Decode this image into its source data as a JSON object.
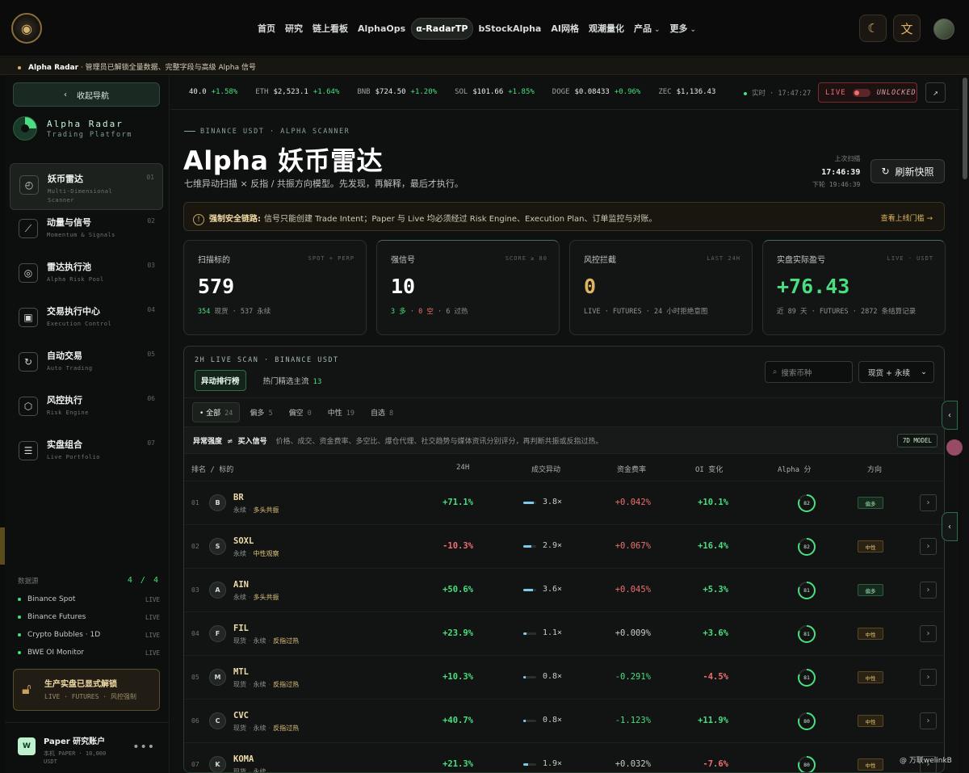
{
  "nav": {
    "links": [
      "首页",
      "研究",
      "链上看板",
      "AlphaOps",
      "α-RadarTP",
      "bStockAlpha",
      "AI网格",
      "观潮量化"
    ],
    "active_index": 4,
    "dropdowns": [
      "产品",
      "更多"
    ]
  },
  "banner": {
    "strong": "Alpha Radar",
    "text": " · 管理员已解锁全量数据、完整字段与高级 Alpha 信号"
  },
  "sidebar": {
    "collapse_label": "收起导航",
    "brand_title": "Alpha Radar",
    "brand_sub": "Trading Platform",
    "items": [
      {
        "label": "妖币雷达",
        "sub": "Multi-Dimensional Scanner",
        "num": "01",
        "icon": "◴"
      },
      {
        "label": "动量与信号",
        "sub": "Momentum & Signals",
        "num": "02",
        "icon": "⟋"
      },
      {
        "label": "雷达执行池",
        "sub": "Alpha Risk Pool",
        "num": "03",
        "icon": "◎"
      },
      {
        "label": "交易执行中心",
        "sub": "Execution Control",
        "num": "04",
        "icon": "▣"
      },
      {
        "label": "自动交易",
        "sub": "Auto Trading",
        "num": "05",
        "icon": "↻"
      },
      {
        "label": "风控执行",
        "sub": "Risk Engine",
        "num": "06",
        "icon": "⬡"
      },
      {
        "label": "实盘组合",
        "sub": "Live Portfolio",
        "num": "07",
        "icon": "☰"
      }
    ],
    "sources_label": "数据源",
    "sources_count": "4 / 4",
    "sources": [
      {
        "name": "Binance Spot",
        "status": "LIVE"
      },
      {
        "name": "Binance Futures",
        "status": "LIVE"
      },
      {
        "name": "Crypto Bubbles · 1D",
        "status": "LIVE"
      },
      {
        "name": "BWE OI Monitor",
        "status": "LIVE"
      }
    ],
    "unlock_title": "生产实盘已显式解锁",
    "unlock_sub": "LIVE · FUTURES · 风控强制",
    "account_initial": "W",
    "account_name": "Paper 研究账户",
    "account_sub": "本机 PAPER · 10,000 USDT",
    "account_more": "•••"
  },
  "ticker": [
    {
      "sym": "",
      "price": "40.0",
      "chg": "+1.58%"
    },
    {
      "sym": "ETH",
      "price": "$2,523.1",
      "chg": "+1.64%"
    },
    {
      "sym": "BNB",
      "price": "$724.50",
      "chg": "+1.20%"
    },
    {
      "sym": "SOL",
      "price": "$101.66",
      "chg": "+1.85%"
    },
    {
      "sym": "DOGE",
      "price": "$0.08433",
      "chg": "+0.96%"
    },
    {
      "sym": "ZEC",
      "price": "$1,136.43",
      "chg": ""
    }
  ],
  "realtime": "实时 · 17:47:27",
  "live_label": "LIVE",
  "unlocked_label": "UNLOCKED",
  "header": {
    "eyebrow": "BINANCE USDT · ALPHA SCANNER",
    "title": "Alpha 妖币雷达",
    "desc": "七维异动扫描 × 反指 / 共振方向模型。先发现，再解释，最后才执行。",
    "last_scan_label": "上次扫描",
    "last_scan_time": "17:46:39",
    "next_scan": "下轮 19:46:39",
    "refresh_label": "刷新快照"
  },
  "alert": {
    "strong": "强制安全链路:",
    "text": "信号只能创建 Trade Intent；Paper 与 Live 均必须经过 Risk Engine、Execution Plan、订单监控与对账。",
    "link": "查看上线门槛 →"
  },
  "stats": [
    {
      "label": "扫描标的",
      "tag": "SPOT + PERP",
      "value": "579",
      "sub": [
        {
          "t": "354",
          "c": "g"
        },
        {
          "t": " 现货 · 537 永续",
          "c": ""
        }
      ]
    },
    {
      "label": "强信号",
      "tag": "SCORE ≥ 80",
      "value": "10",
      "sub": [
        {
          "t": "3 多",
          "c": "g"
        },
        {
          "t": " · ",
          "c": ""
        },
        {
          "t": "0 空",
          "c": "r"
        },
        {
          "t": " · 6 过热",
          "c": ""
        }
      ]
    },
    {
      "label": "风控拦截",
      "tag": "LAST 24H",
      "value": "0",
      "sub": [
        {
          "t": "LIVE · FUTURES · 24 小时拒绝意图",
          "c": ""
        }
      ]
    },
    {
      "label": "实盘实际盈亏",
      "tag": "LIVE · USDT",
      "value": "+76.43",
      "sub": [
        {
          "t": "近 89 天 · FUTURES · 2872 条结算记录",
          "c": ""
        }
      ]
    }
  ],
  "panel": {
    "eyebrow": "2H LIVE SCAN · BINANCE USDT",
    "tabs": [
      {
        "label": "异动排行榜",
        "count": ""
      },
      {
        "label": "热门精选主流",
        "count": "13"
      }
    ],
    "search_placeholder": "搜索币种",
    "market_select": "现货 + 永续",
    "filters": [
      {
        "label": "全部",
        "count": "24"
      },
      {
        "label": "偏多",
        "count": "5"
      },
      {
        "label": "偏空",
        "count": "0"
      },
      {
        "label": "中性",
        "count": "19"
      },
      {
        "label": "自选",
        "count": "8"
      }
    ],
    "note_key": "异常强度",
    "note_ne": "≠",
    "note_key2": "买入信号",
    "note_text": "价格、成交、资金费率、多空比、爆仓代理、社交趋势与媒体资讯分别评分，再判断共振或反指过热。",
    "model_badge": "7D MODEL",
    "columns": [
      "排名 / 标的",
      "24H",
      "成交异动",
      "资金费率",
      "OI 变化",
      "Alpha 分",
      "方向"
    ]
  },
  "rows": [
    {
      "rank": "01",
      "sym": "BR",
      "tags": [
        "永续",
        "多头共振"
      ],
      "c24": "+71.1%",
      "vol": 0.8,
      "volx": "3.8×",
      "fr": "+0.042%",
      "oi": "+10.1%",
      "score": 82,
      "dir": "偏多",
      "dtype": "long"
    },
    {
      "rank": "02",
      "sym": "SOXL",
      "tags": [
        "永续",
        "中性观察"
      ],
      "c24": "-10.3%",
      "vol": 0.62,
      "volx": "2.9×",
      "fr": "+0.067%",
      "oi": "+16.4%",
      "score": 82,
      "dir": "中性",
      "dtype": "neu"
    },
    {
      "rank": "03",
      "sym": "AIN",
      "tags": [
        "永续",
        "多头共振"
      ],
      "c24": "+50.6%",
      "vol": 0.75,
      "volx": "3.6×",
      "fr": "+0.045%",
      "oi": "+5.3%",
      "score": 81,
      "dir": "偏多",
      "dtype": "long"
    },
    {
      "rank": "04",
      "sym": "FIL",
      "tags": [
        "现货",
        "永续",
        "反指过热"
      ],
      "c24": "+23.9%",
      "vol": 0.24,
      "volx": "1.1×",
      "fr": "+0.009%",
      "oi": "+3.6%",
      "score": 81,
      "dir": "中性",
      "dtype": "neu"
    },
    {
      "rank": "05",
      "sym": "MTL",
      "tags": [
        "现货",
        "永续",
        "反指过热"
      ],
      "c24": "+10.3%",
      "vol": 0.18,
      "volx": "0.8×",
      "fr": "-0.291%",
      "oi": "-4.5%",
      "score": 81,
      "dir": "中性",
      "dtype": "neu"
    },
    {
      "rank": "06",
      "sym": "CVC",
      "tags": [
        "现货",
        "永续",
        "反指过热"
      ],
      "c24": "+40.7%",
      "vol": 0.18,
      "volx": "0.8×",
      "fr": "-1.123%",
      "oi": "+11.9%",
      "score": 80,
      "dir": "中性",
      "dtype": "neu"
    },
    {
      "rank": "07",
      "sym": "KOMA",
      "tags": [
        "现货",
        "永续"
      ],
      "c24": "+21.3%",
      "vol": 0.4,
      "volx": "1.9×",
      "fr": "+0.032%",
      "oi": "-7.6%",
      "score": 80,
      "dir": "中性",
      "dtype": "neu"
    }
  ],
  "watermark": "@ 万联welinkB",
  "colors": {
    "accent": "#4ade80",
    "negative": "#ef6f6f",
    "gold": "#e0b562",
    "bg": "#0f1110"
  }
}
